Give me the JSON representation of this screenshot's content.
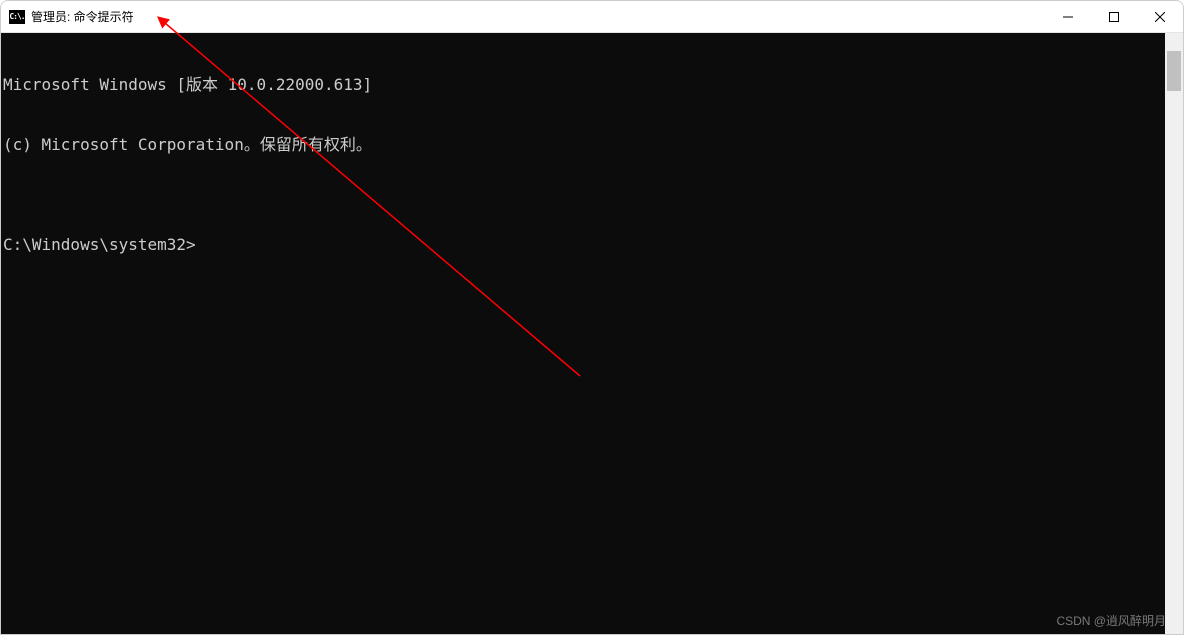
{
  "window": {
    "title": "管理员: 命令提示符",
    "icon_label": "C:\\."
  },
  "controls": {
    "minimize": "Minimize",
    "maximize": "Maximize",
    "close": "Close"
  },
  "terminal": {
    "line1": "Microsoft Windows [版本 10.0.22000.613]",
    "line2": "(c) Microsoft Corporation。保留所有权利。",
    "blank": "",
    "prompt": "C:\\Windows\\system32>"
  },
  "watermark": "CSDN @逍风醉明月"
}
